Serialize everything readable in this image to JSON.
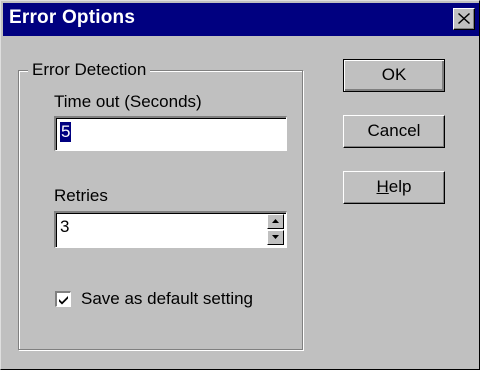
{
  "window": {
    "title": "Error Options",
    "close_glyph": "close-icon"
  },
  "group": {
    "legend": "Error Detection"
  },
  "timeout": {
    "label": "Time out (Seconds)",
    "value": "5"
  },
  "retries": {
    "label": "Retries",
    "value": "3"
  },
  "checkbox": {
    "label": "Save as default setting",
    "checked": true
  },
  "buttons": {
    "ok": "OK",
    "cancel": "Cancel",
    "help_mnemonic": "H",
    "help_rest": "elp"
  },
  "colors": {
    "titlebar": "#000080",
    "face": "#c0c0c0",
    "selection": "#000080"
  }
}
